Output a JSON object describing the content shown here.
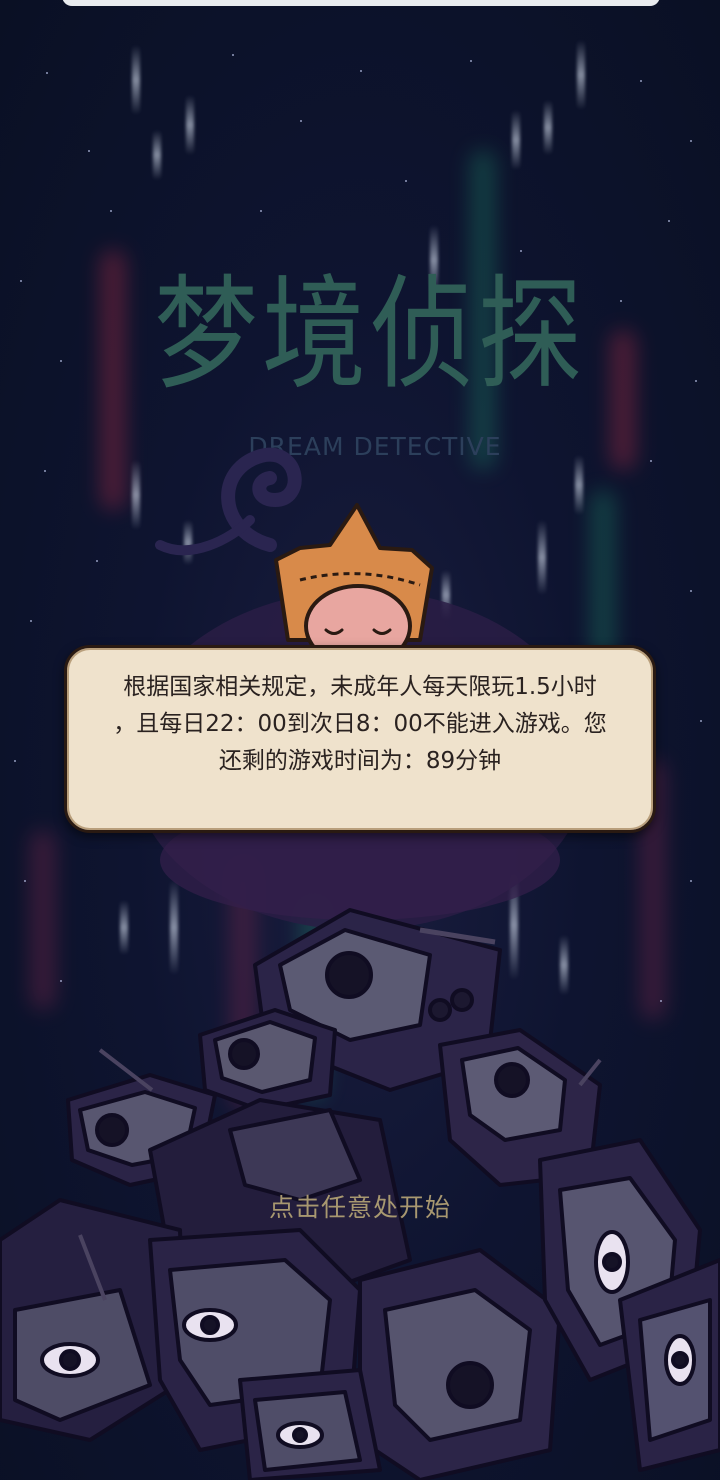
{
  "game": {
    "logo_cn": "梦境侦探",
    "logo_en": "DREAM DETECTIVE"
  },
  "notice": {
    "text": "根据国家相关规定，未成年人每天限玩1.5小时\n，且每日22：00到次日8：00不能进入游戏。您\n还剩的游戏时间为：89分钟"
  },
  "start": {
    "hint": "点击任意处开始"
  },
  "colors": {
    "background": "#0b1226",
    "logo": "#2f5d56",
    "dialog": "#efe2cc",
    "hint": "#a89870"
  },
  "icons": {
    "tv_pile": "tv-pile-illustration",
    "detective": "detective-character-illustration"
  }
}
